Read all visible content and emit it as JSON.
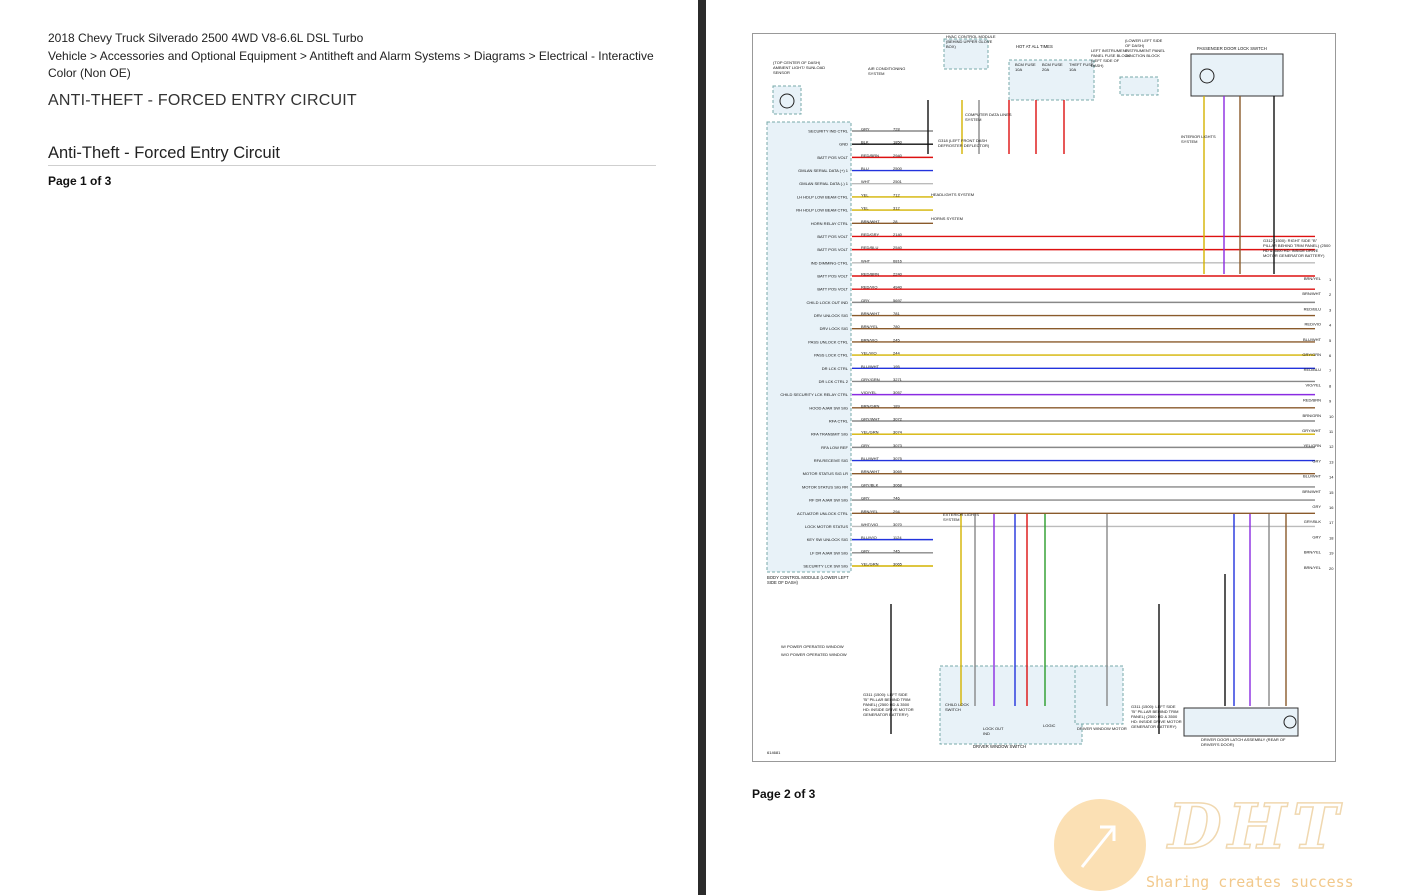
{
  "page1": {
    "vehicle": "2018 Chevy Truck Silverado 2500 4WD V8-6.6L DSL Turbo",
    "breadcrumb": "Vehicle > Accessories and Optional Equipment > Antitheft and Alarm Systems > Diagrams > Electrical - Interactive Color (Non OE)",
    "doc_title": "ANTI-THEFT - FORCED ENTRY CIRCUIT",
    "section_title": "Anti-Theft - Forced Entry Circuit",
    "page_label": "Page 1 of 3"
  },
  "page2": {
    "page_label": "Page 2 of 3",
    "watermark_tagline": "Sharing creates success",
    "watermark_letters": "DHT"
  },
  "diagram": {
    "bcm_label": "BODY CONTROL MODULE (LOWER LEFT SIDE OF DASH)",
    "hot_at_all_times": "HOT AT ALL TIMES",
    "fuse_block": "LEFT INSTRUMENT PANEL FUSE BLOCK (LEFT SIDE OF DASH)",
    "junction_block": "(LOWER LEFT SIDE OF DASH) INSTRUMENT PANEL JUNCTION BLOCK",
    "passenger_switch": "PASSENGER DOOR LOCK SWITCH",
    "hvac": "HVAC CONTROL MODULE (BEHIND UPPER GLOVE BOX)",
    "sunload": "(TOP CENTER OF DASH) AMBIENT LIGHT/ SUNLOAD SENSOR",
    "air_cond": "AIR CONDITIONING SYSTEM",
    "computer_data": "COMPUTER DATA LINES SYSTEM",
    "headlights": "HEADLIGHTS SYSTEM",
    "horns": "HORNS SYSTEM",
    "exterior_lights": "EXTERIOR LIGHTS SYSTEM",
    "interior_lights": "INTERIOR LIGHTS SYSTEM",
    "driver_window_switch": "DRIVER WINDOW SWITCH",
    "driver_window_motor": "DRIVER WINDOW MOTOR",
    "driver_latch": "DRIVER DOOR LATCH ASSEMBLY (REAR OF DRIVER'S DOOR)",
    "child_lock_switch": "CHILD LOCK SWITCH",
    "lock_out_ind": "LOCK OUT IND",
    "logic": "LOGIC",
    "g311": "G311 (1500): LEFT SIDE \"B\" PILLAR BEHIND TRIM PANEL) (2500 HD & 3500 HD: INSIDE DRIVE MOTOR GENERATOR BATTERY)",
    "g312": "G312 (1500): RIGHT SIDE \"B\" PILLAR BEHIND TRIM PANEL) (2500 HD & 3500 HD: INSIDE DRIVE MOTOR GENERATOR BATTERY)",
    "g318": "G318 (LEFT FRONT DASH DEFROSTER DEFLECTOR)",
    "legend_1": "W/ POWER OPERATED WINDOW",
    "legend_2": "W/O POWER OPERATED WINDOW",
    "diagram_id": "614681",
    "fuses": [
      "BCM FUSE 10A",
      "BCM FUSE 20A",
      "THEFT FUSE 10A"
    ],
    "bcm_pins": [
      "SECURITY IND CTRL",
      "GND",
      "BATT POS VOLT",
      "GMLAN SERIAL DATA (+) 1",
      "GMLAN SERIAL DATA (-) 1",
      "LH HDLP LOW BEAM CTRL",
      "RH HDLP LOW BEAM CTRL",
      "HORN RELAY CTRL",
      "BATT POS VOLT",
      "BATT POS VOLT",
      "IND DIMMING CTRL",
      "BATT POS VOLT",
      "BATT POS VOLT",
      "CHILD LOCK OUT IND",
      "DRV UNLOCK SIG",
      "DRV LOCK SIG",
      "PASS UNLOCK CTRL",
      "PASS LOCK CTRL",
      "DR LCK CTRL",
      "DR LCK CTRL 2",
      "CHILD SECURITY LCK RELAY CTRL",
      "HOOD AJAR SW SIG",
      "RFA CTRL",
      "RFA TRANSMIT SIG",
      "RFA LOW REF",
      "RFA RECEIVE SIG",
      "MOTOR STATUS SIG LR",
      "MOTOR STATUS SIG RR",
      "RF DR AJAR SW SIG",
      "ACTUATOR UNLOCK CTRL",
      "LOCK MOTOR STATUS",
      "KEY SW UNLOCK SIG",
      "LF DR AJAR SW SIG",
      "SECURITY LCK SW SIG"
    ],
    "wires": [
      {
        "color": "GRY",
        "circuit": "728"
      },
      {
        "color": "BLK",
        "circuit": "1850"
      },
      {
        "color": "RED/BRN",
        "circuit": "2940"
      },
      {
        "color": "BLU",
        "circuit": "2500"
      },
      {
        "color": "WHT",
        "circuit": "2501"
      },
      {
        "color": "YEL",
        "circuit": "712"
      },
      {
        "color": "YEL",
        "circuit": "312"
      },
      {
        "color": "BRN/WHT",
        "circuit": "28"
      },
      {
        "color": "RED/GRY",
        "circuit": "2140"
      },
      {
        "color": "RED/BLU",
        "circuit": "2540"
      },
      {
        "color": "WHT",
        "circuit": "6816"
      },
      {
        "color": "RED/BRN",
        "circuit": "2240"
      },
      {
        "color": "RED/VIO",
        "circuit": "4940"
      },
      {
        "color": "GRY",
        "circuit": "5697"
      },
      {
        "color": "BRN/WHT",
        "circuit": "781"
      },
      {
        "color": "BRN/YEL",
        "circuit": "780"
      },
      {
        "color": "BRN/VIO",
        "circuit": "245"
      },
      {
        "color": "YEL/VIO",
        "circuit": "244"
      },
      {
        "color": "BLU/WHT",
        "circuit": "195"
      },
      {
        "color": "GRY/GRN",
        "circuit": "3271"
      },
      {
        "color": "VIO/YEL",
        "circuit": "3057"
      },
      {
        "color": "BRN/GRN",
        "circuit": "189"
      },
      {
        "color": "GRY/WHT",
        "circuit": "3072"
      },
      {
        "color": "YEL/GRN",
        "circuit": "3074"
      },
      {
        "color": "GRY",
        "circuit": "3073"
      },
      {
        "color": "BLU/WHT",
        "circuit": "3075"
      },
      {
        "color": "BRN/WHT",
        "circuit": "3069"
      },
      {
        "color": "GRY/BLK",
        "circuit": "3068"
      },
      {
        "color": "GRY",
        "circuit": "746"
      },
      {
        "color": "BRN/YEL",
        "circuit": "294"
      },
      {
        "color": "WHT/VIO",
        "circuit": "3070"
      },
      {
        "color": "BLU/VIO",
        "circuit": "1124"
      },
      {
        "color": "GRY",
        "circuit": "745"
      },
      {
        "color": "YEL/GRN",
        "circuit": "3065"
      }
    ],
    "right_labels": [
      "BRN/YEL",
      "BRN/WHT",
      "RED/BLU",
      "RED/VIO",
      "BLU/WHT",
      "GRY/GRN",
      "RED/BLU",
      "VIO/YEL",
      "RED/BRN",
      "BRN/GRN",
      "GRY/WHT",
      "YEL/GRN",
      "GRY",
      "BLU/WHT",
      "BRN/WHT",
      "GRY",
      "GRY/BLK",
      "GRY",
      "BRN/YEL",
      "BRN/YEL"
    ],
    "right_numbers": [
      "1",
      "2",
      "3",
      "4",
      "5",
      "6",
      "7",
      "8",
      "9",
      "10",
      "11",
      "12",
      "13",
      "14",
      "15",
      "16",
      "17",
      "18",
      "19",
      "20"
    ]
  }
}
